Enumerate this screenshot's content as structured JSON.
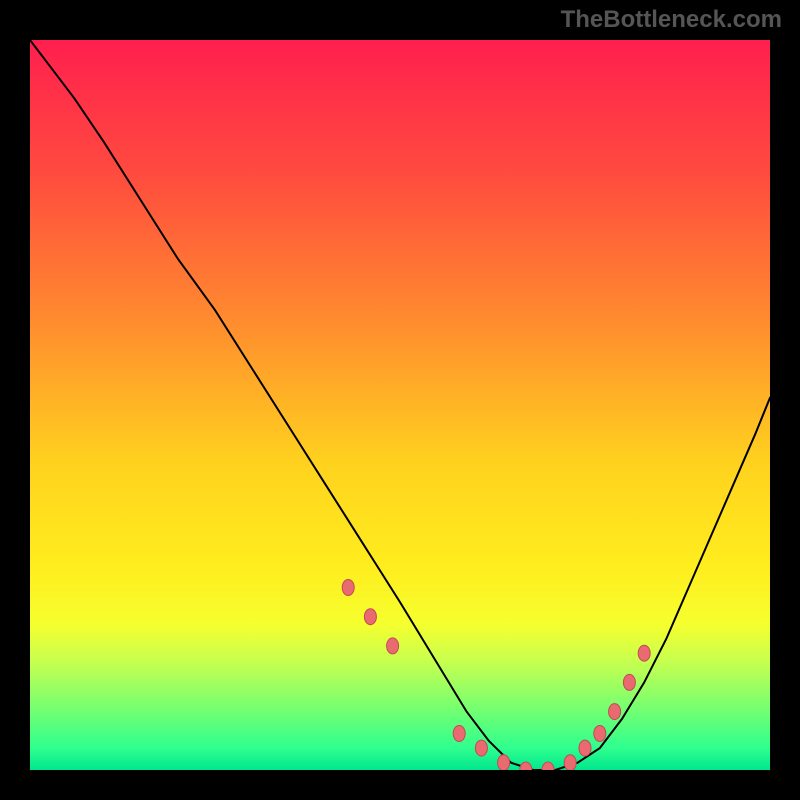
{
  "watermark": "TheBottleneck.com",
  "colors": {
    "marker_fill": "#e96b70",
    "marker_stroke": "#c24a55",
    "curve_stroke": "#000000"
  },
  "chart_data": {
    "type": "line",
    "title": "",
    "xlabel": "",
    "ylabel": "",
    "xlim": [
      0,
      100
    ],
    "ylim": [
      0,
      100
    ],
    "x": [
      0,
      3,
      6,
      10,
      15,
      20,
      25,
      30,
      35,
      40,
      45,
      50,
      53,
      56,
      59,
      62,
      65,
      68,
      71,
      74,
      77,
      80,
      83,
      86,
      89,
      92,
      95,
      98,
      100
    ],
    "values": [
      100,
      96,
      92,
      86,
      78,
      70,
      63,
      55,
      47,
      39,
      31,
      23,
      18,
      13,
      8,
      4,
      1,
      0,
      0,
      1,
      3,
      7,
      12,
      18,
      25,
      32,
      39,
      46,
      51
    ],
    "marker_x": [
      43,
      46,
      49,
      58,
      61,
      64,
      67,
      70,
      73,
      75,
      77,
      79,
      81,
      83
    ],
    "marker_y": [
      25,
      21,
      17,
      5,
      3,
      1,
      0,
      0,
      1,
      3,
      5,
      8,
      12,
      16
    ]
  }
}
